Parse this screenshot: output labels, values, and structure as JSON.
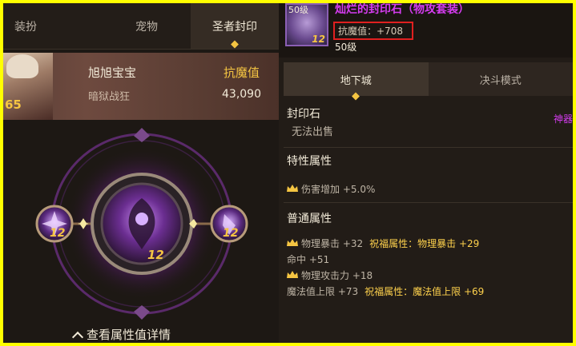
{
  "left": {
    "tabs": [
      "装扮",
      "宠物",
      "圣者封印"
    ],
    "active_tab": 2,
    "profile": {
      "name": "旭旭宝宝",
      "job": "暗狱战狂",
      "level": "65",
      "resist_label": "抗魔值",
      "resist_value": "43,090"
    },
    "sigil": {
      "center_level": "12",
      "left_level": "12",
      "right_level": "12"
    },
    "bottom_link": "查看属性值详情"
  },
  "right": {
    "item": {
      "icon_level": "50级",
      "icon_num": "12",
      "name": "灿烂的封印石（物攻套装）",
      "resist": "抗魔值：+708",
      "level": "50级"
    },
    "mode_tabs": [
      "地下城",
      "决斗模式"
    ],
    "active_mode": 0,
    "side_label": "神器",
    "sections": {
      "seal_title": "封印石",
      "seal_desc": "无法出售",
      "trait_title": "特性属性",
      "trait_line": "伤害增加 +5.0%",
      "normal_title": "普通属性",
      "normal_lines": [
        {
          "text": "物理暴击 +32",
          "extra": "祝福属性：物理暴击 +29",
          "crown": true
        },
        {
          "text": "命中 +51",
          "extra": "",
          "crown": false
        },
        {
          "text": "物理攻击力 +18",
          "extra": "",
          "crown": true
        },
        {
          "text": "魔法值上限 +73",
          "extra": "祝福属性：魔法值上限 +69",
          "crown": false
        }
      ]
    }
  },
  "colors": {
    "gold": "#f5c542",
    "purple": "#d53cf0",
    "highlight_red": "#e02020",
    "frame_yellow": "#ffff00"
  }
}
